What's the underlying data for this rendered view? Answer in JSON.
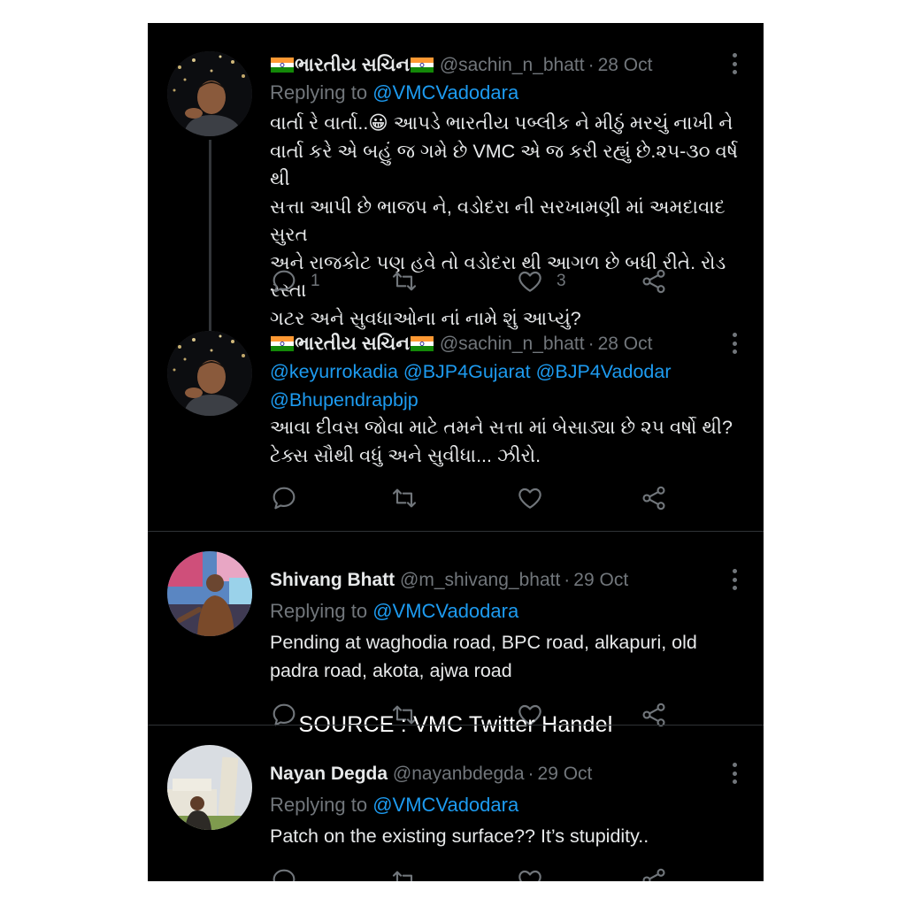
{
  "tweets": [
    {
      "name": "ભારતીય સચિન",
      "handle": "@sachin_n_bhatt",
      "date": "28 Oct",
      "replying_prefix": "Replying to",
      "replying_to": "@VMCVadodara",
      "mentions": "",
      "text": [
        "વાર્તા રે વાર્તા..😀 આપડે ભારતીય પબ્લીક ને મીઠું મરચું નાખી ને",
        "વાર્તા કરે એ બહું જ ગમે છે VMC એ જ કરી રહ્યું છે.૨૫-૩૦ વર્ષ થી",
        "સત્તા આપી છે ભાજપ ને, વડોદરા ની સરખામણી માં અમદાવાદ સુરત",
        "અને રાજકોટ પણ હવે તો વડોદરા થી આગળ છે બધી રીતે. રોડ રસ્તા",
        "ગટર અને સુવધાઓના નાં નામે શું આપ્યું?"
      ],
      "reply_count": "1",
      "retweet_count": "",
      "like_count": "3"
    },
    {
      "name": "ભારતીય સચિન",
      "handle": "@sachin_n_bhatt",
      "date": "28 Oct",
      "mentions": [
        "@keyurrokadia @BJP4Gujarat @BJP4Vadodar",
        "@Bhupendrapbjp"
      ],
      "text": [
        "આવા દીવસ જોવા માટે તમને સત્તા માં બેસાડ્યા છે ૨૫ વર્ષો થી?",
        "ટેક્સ સૌથી વધું અને સુવીધા... ઝીરો."
      ],
      "reply_count": "",
      "retweet_count": "",
      "like_count": ""
    },
    {
      "name": "Shivang Bhatt",
      "handle": "@m_shivang_bhatt",
      "date": "29 Oct",
      "replying_prefix": "Replying to",
      "replying_to": "@VMCVadodara",
      "text": [
        "Pending at waghodia road, BPC road, alkapuri, old",
        "padra road, akota, ajwa road"
      ],
      "reply_count": "",
      "retweet_count": "",
      "like_count": ""
    },
    {
      "name": "Nayan Degda",
      "handle": "@nayanbdegda",
      "date": "29 Oct",
      "replying_prefix": "Replying to",
      "replying_to": "@VMCVadodara",
      "text": [
        "Patch on the existing surface?? It’s stupidity.."
      ],
      "reply_count": "",
      "retweet_count": "",
      "like_count": ""
    }
  ],
  "separator_dot": "·",
  "watermark": "SOURCE : VMC Twitter Handel",
  "icons": {
    "reply": "reply-icon",
    "retweet": "retweet-icon",
    "like": "heart-icon",
    "share": "share-icon",
    "more": "more-options-icon",
    "flag": "india-flag-icon"
  },
  "colors": {
    "background": "#000000",
    "text": "#e7e9ea",
    "muted": "#71767b",
    "link": "#1d9bf0",
    "divider": "#2f3336"
  }
}
